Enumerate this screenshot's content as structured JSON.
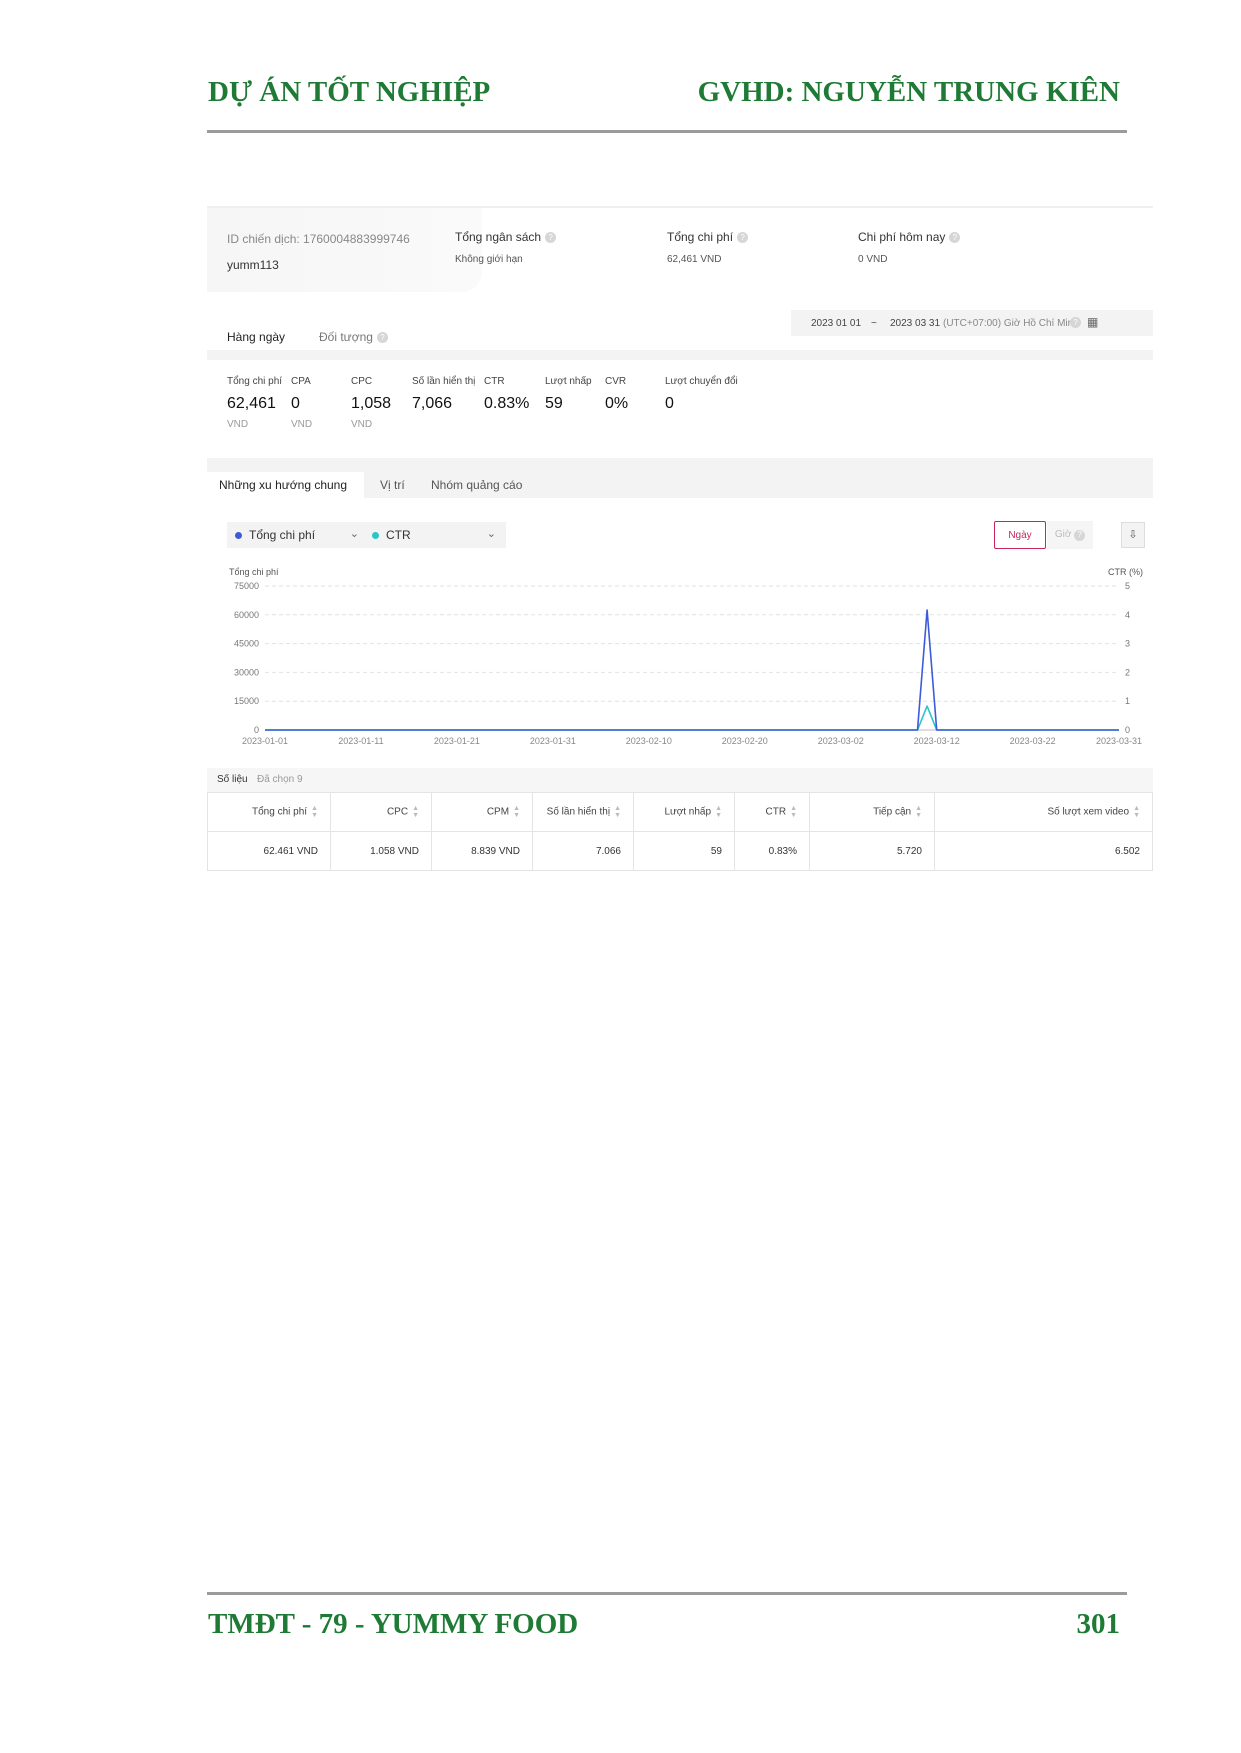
{
  "page": {
    "header_left": "DỰ ÁN TỐT NGHIỆP",
    "header_right": "GVHD: NGUYỄN TRUNG KIÊN",
    "footer_left": "TMĐT - 79 - YUMMY FOOD",
    "footer_right": "301"
  },
  "campaign": {
    "id_label": "ID chiến dịch: 1760004883999746",
    "name": "yumm113",
    "stats": [
      {
        "label": "Tổng ngân sách",
        "value": "Không giới hạn"
      },
      {
        "label": "Tổng chi phí",
        "value": "62,461 VND"
      },
      {
        "label": "Chi phí hôm nay",
        "value": "0 VND"
      }
    ]
  },
  "tabs": {
    "daily": "Hàng ngày",
    "audience": "Đối tượng"
  },
  "date_range": {
    "start": "2023 01 01",
    "sep": "~",
    "end": "2023 03 31",
    "timezone": "(UTC+07:00) Giờ Hồ Chí Minh"
  },
  "metrics": [
    {
      "label": "Tổng chi phí",
      "value": "62,461",
      "unit": "VND"
    },
    {
      "label": "CPA",
      "value": "0",
      "unit": "VND"
    },
    {
      "label": "CPC",
      "value": "1,058",
      "unit": "VND"
    },
    {
      "label": "Số lần hiển thị",
      "value": "7,066",
      "unit": ""
    },
    {
      "label": "CTR",
      "value": "0.83%",
      "unit": ""
    },
    {
      "label": "Lượt nhấp",
      "value": "59",
      "unit": ""
    },
    {
      "label": "CVR",
      "value": "0%",
      "unit": ""
    },
    {
      "label": "Lượt chuyển đổi",
      "value": "0",
      "unit": ""
    }
  ],
  "trend_tabs": [
    "Những xu hướng chung",
    "Vị trí",
    "Nhóm quảng cáo"
  ],
  "selectors": {
    "metric1": "Tổng chi phí",
    "metric2": "CTR",
    "metric1_color": "#3d5bd9",
    "metric2_color": "#2bc4c9",
    "btn_day": "Ngày",
    "btn_hour": "Giờ"
  },
  "chart_data": {
    "type": "line",
    "ylabel_left": "Tổng chi phí",
    "ylabel_right": "CTR (%)",
    "ylim_left": [
      0,
      75000
    ],
    "ylim_right": [
      0,
      5
    ],
    "yticks_left": [
      "75000",
      "60000",
      "45000",
      "30000",
      "15000",
      "0"
    ],
    "yticks_right": [
      "5",
      "4",
      "3",
      "2",
      "1",
      "0"
    ],
    "x_ticks": [
      "2023-01-01",
      "2023-01-11",
      "2023-01-21",
      "2023-01-31",
      "2023-02-10",
      "2023-02-20",
      "2023-03-02",
      "2023-03-12",
      "2023-03-22",
      "2023-03-31"
    ],
    "grid": true,
    "series": [
      {
        "name": "Tổng chi phí",
        "axis": "left",
        "color": "#3d5bd9",
        "points": [
          [
            "2023-01-01",
            0
          ],
          [
            "2023-03-10",
            0
          ],
          [
            "2023-03-11",
            62461
          ],
          [
            "2023-03-12",
            0
          ],
          [
            "2023-03-31",
            0
          ]
        ]
      },
      {
        "name": "CTR",
        "axis": "right",
        "color": "#2bc4c9",
        "points": [
          [
            "2023-01-01",
            0
          ],
          [
            "2023-03-10",
            0
          ],
          [
            "2023-03-11",
            0.83
          ],
          [
            "2023-03-12",
            0
          ],
          [
            "2023-03-31",
            0
          ]
        ]
      }
    ]
  },
  "data_table": {
    "title": "Số liệu",
    "selected": "Đã chọn 9",
    "columns": [
      "Tổng chi phí",
      "CPC",
      "CPM",
      "Số lần hiển thị",
      "Lượt nhấp",
      "CTR",
      "Tiếp cận",
      "Số lượt xem video"
    ],
    "rows": [
      [
        "62.461 VND",
        "1.058 VND",
        "8.839 VND",
        "7.066",
        "59",
        "0.83%",
        "5.720",
        "6.502"
      ]
    ]
  }
}
